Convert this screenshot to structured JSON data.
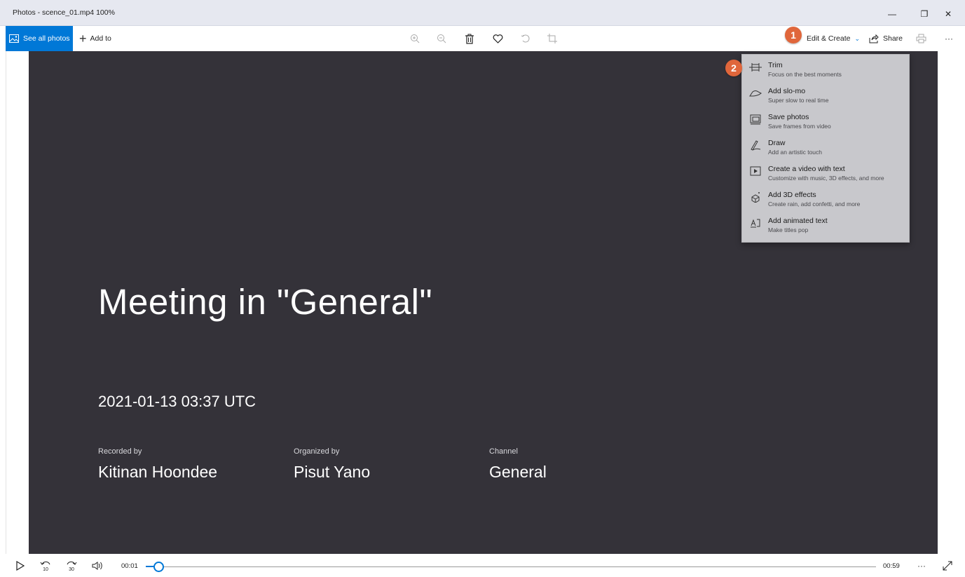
{
  "window": {
    "title": "Photos - scence_01.mp4   100%",
    "minimize_glyph": "—",
    "restore_glyph": "❐",
    "close_glyph": "✕"
  },
  "toolbar": {
    "see_all_photos": "See all photos",
    "add_to": "Add to",
    "add_to_glyph": "+",
    "edit_create": "Edit & Create",
    "edit_create_chevron": "⌄",
    "share": "Share",
    "more_glyph": "···",
    "icons": [
      "zoom-in-icon",
      "zoom-out-icon",
      "delete-icon",
      "heart-icon",
      "rotate-icon",
      "crop-icon",
      "print-icon",
      "more-icon"
    ]
  },
  "badges": {
    "step1": "1",
    "step2": "2",
    "color": "#e0663b"
  },
  "menu": {
    "items": [
      {
        "label": "Trim",
        "desc": "Focus on the best moments",
        "icon": "trim-icon"
      },
      {
        "label": "Add slo-mo",
        "desc": "Super slow to real time",
        "icon": "slo-mo-icon"
      },
      {
        "label": "Save photos",
        "desc": "Save frames from video",
        "icon": "save-photos-icon"
      },
      {
        "label": "Draw",
        "desc": "Add an artistic touch",
        "icon": "draw-icon"
      },
      {
        "label": "Create a video with text",
        "desc": "Customize with music, 3D effects, and more",
        "icon": "video-text-icon"
      },
      {
        "label": "Add 3D effects",
        "desc": "Create rain, add confetti, and more",
        "icon": "3d-effects-icon"
      },
      {
        "label": "Add animated text",
        "desc": "Make titles pop",
        "icon": "animated-text-icon"
      }
    ]
  },
  "video": {
    "title": "Meeting in \"General\"",
    "date": "2021-01-13 03:37 UTC",
    "recorded_by_label": "Recorded by",
    "recorded_by": "Kitinan Hoondee",
    "organized_by_label": "Organized by",
    "organized_by": "Pisut Yano",
    "channel_label": "Channel",
    "channel": "General",
    "background_color": "#343239"
  },
  "player": {
    "current_time": "00:01",
    "duration": "00:59",
    "progress": 0.017,
    "back_label": "10",
    "forward_label": "30",
    "more_glyph": "···",
    "accent_color": "#0078d7"
  }
}
